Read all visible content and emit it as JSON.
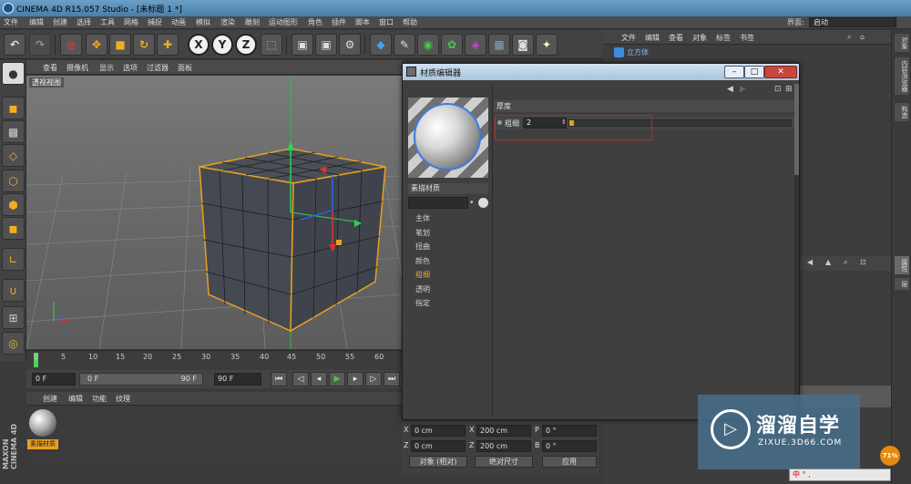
{
  "window": {
    "title": "CINEMA 4D R15.057 Studio - [未标题 1 *]"
  },
  "menubar": {
    "items": [
      "文件",
      "编辑",
      "创建",
      "选择",
      "工具",
      "网格",
      "捕捉",
      "动画",
      "模拟",
      "渲染",
      "雕刻",
      "运动图形",
      "角色",
      "插件",
      "脚本",
      "窗口",
      "帮助"
    ],
    "layout_label": "界面:",
    "layout_value": "启动"
  },
  "toolbar": {
    "axis_x": "X",
    "axis_y": "Y",
    "axis_z": "Z"
  },
  "viewport": {
    "menu": [
      "查看",
      "摄像机",
      "显示",
      "选项",
      "过滤器",
      "面板"
    ],
    "label": "透视视图"
  },
  "timeline": {
    "ticks": [
      "0",
      "5",
      "10",
      "15",
      "20",
      "25",
      "30",
      "35",
      "40",
      "45",
      "50",
      "55",
      "60"
    ],
    "start": "0 F",
    "current": "0 F",
    "range_end": "90 F",
    "end": "90 F"
  },
  "material_manager": {
    "menu": [
      "创建",
      "编辑",
      "功能",
      "纹理"
    ],
    "material_label": "素描材质"
  },
  "maxon_logo": "MAXON CINEMA 4D",
  "coordinates": {
    "rows": [
      {
        "l1": "X",
        "v1": "0 cm",
        "l2": "X",
        "v2": "200 cm",
        "l3": "P",
        "v3": "0 °"
      },
      {
        "l1": "Z",
        "v1": "0 cm",
        "l2": "Z",
        "v2": "200 cm",
        "l3": "B",
        "v3": "0 °"
      }
    ],
    "mode": "对象 (相对)",
    "size_mode": "绝对尺寸",
    "apply": "应用"
  },
  "object_manager": {
    "menu": [
      "文件",
      "编辑",
      "查看",
      "对象",
      "标签",
      "书签"
    ],
    "object_name": "立方体"
  },
  "side_tabs": [
    "对象",
    "内容浏览器",
    "构造",
    "属性",
    "层"
  ],
  "material_editor": {
    "title": "材质编辑器",
    "material_name": "素描材质",
    "channels": [
      {
        "label": "主体",
        "active": false
      },
      {
        "label": "笔划",
        "active": false
      },
      {
        "label": "扭曲",
        "active": false
      },
      {
        "label": "颜色",
        "active": false
      },
      {
        "label": "粗细",
        "active": true
      },
      {
        "label": "透明",
        "active": false
      },
      {
        "label": "指定",
        "active": false
      }
    ],
    "group": "厚度",
    "param_label": "粗细",
    "param_value": "2",
    "param_fill": 0.02
  },
  "watermark": {
    "brand": "溜溜自学",
    "url": "ZIXUE.3D66.COM"
  },
  "badge": "71%",
  "ime": "中 ° ,"
}
